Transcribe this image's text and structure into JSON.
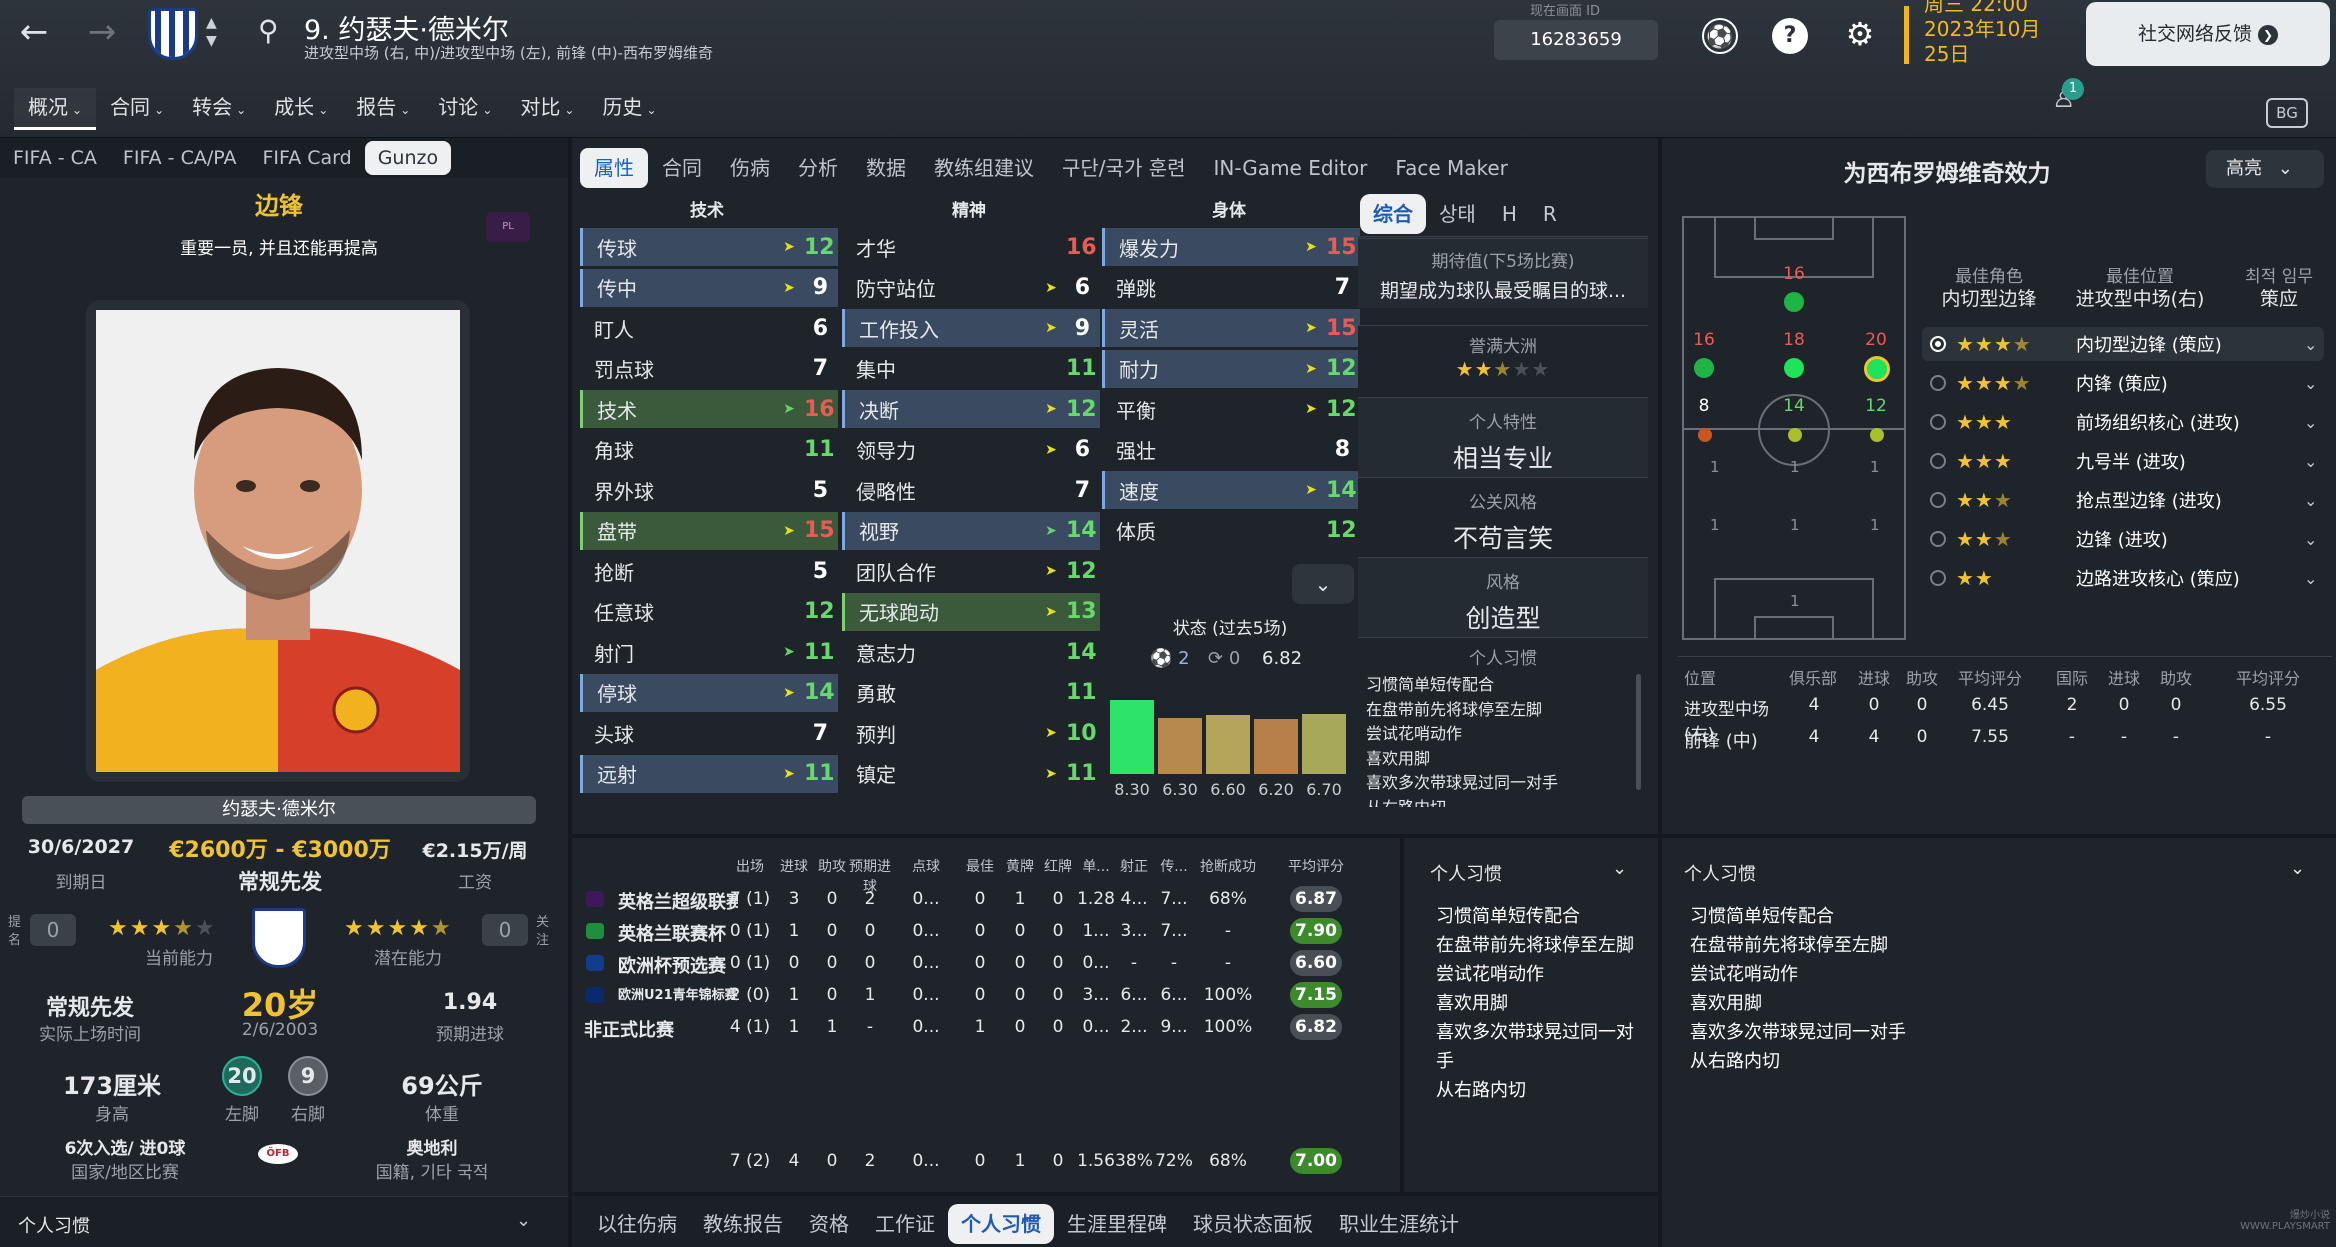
{
  "header": {
    "back_icon": "arrow-left-icon",
    "forward_icon": "arrow-right-icon",
    "player_title": "9. 约瑟夫·德米尔",
    "player_positions": "进攻型中场 (右, 中)/进攻型中场 (左), 前锋 (中)-西布罗姆维奇",
    "id_label": "现在画面 ID",
    "id_value": "16283659",
    "date_line1": "周三 22:00",
    "date_line2": "2023年10月",
    "date_line3": "25日",
    "social_button": "社交网络反馈",
    "notif_count": "1",
    "badge": "BG"
  },
  "main_tabs": [
    {
      "label": "概况"
    },
    {
      "label": "合同"
    },
    {
      "label": "转会"
    },
    {
      "label": "成长"
    },
    {
      "label": "报告"
    },
    {
      "label": "讨论"
    },
    {
      "label": "对比"
    },
    {
      "label": "历史"
    }
  ],
  "sub_tabs": [
    {
      "label": "FIFA - CA"
    },
    {
      "label": "FIFA - CA/PA"
    },
    {
      "label": "FIFA Card"
    },
    {
      "label": "Gunzo"
    }
  ],
  "left": {
    "role": "边锋",
    "role_desc": "重要一员, 并且还能再提高",
    "name_plate": "约瑟夫·德米尔",
    "contract_end": "30/6/2027",
    "contract_end_label": "到期日",
    "value_range": "€2600万 - €3000万",
    "status": "常规先发",
    "wage": "€2.15万/周",
    "wage_label": "工资",
    "left_small_a": "提名",
    "left_box_a": "0",
    "left_small_b": "关注",
    "left_box_b": "0",
    "current_ability_label": "当前能力",
    "potential_label": "潜在能力",
    "playing_time": "常规先发",
    "playing_time_label": "实际上场时间",
    "age": "20岁",
    "dob": "2/6/2003",
    "xg": "1.94",
    "xg_label": "预期进球",
    "height": "173厘米",
    "height_label": "身高",
    "left_foot": "20",
    "left_foot_label": "左脚",
    "right_foot": "9",
    "right_foot_label": "右脚",
    "weight": "69公斤",
    "weight_label": "体重",
    "caps": "6次入选/ 进0球",
    "caps_label": "国家/地区比赛",
    "nation": "奥地利",
    "nation_label": "国籍, 기타 국적",
    "bottom_title": "个人习惯",
    "ofb": "ÖFB"
  },
  "attr_tabs": [
    {
      "label": "属性"
    },
    {
      "label": "合同"
    },
    {
      "label": "伤病"
    },
    {
      "label": "分析"
    },
    {
      "label": "数据"
    },
    {
      "label": "教练组建议"
    },
    {
      "label": "구단/국가 훈련"
    },
    {
      "label": "IN-Game Editor"
    },
    {
      "label": "Face Maker"
    }
  ],
  "attr_headers": {
    "technical": "技术",
    "mental": "精神",
    "physical": "身体"
  },
  "technical": [
    {
      "name": "传球",
      "value": "12"
    },
    {
      "name": "传中",
      "value": "9"
    },
    {
      "name": "盯人",
      "value": "6"
    },
    {
      "name": "罚点球",
      "value": "7"
    },
    {
      "name": "技术",
      "value": "16"
    },
    {
      "name": "角球",
      "value": "11"
    },
    {
      "name": "界外球",
      "value": "5"
    },
    {
      "name": "盘带",
      "value": "15"
    },
    {
      "name": "抢断",
      "value": "5"
    },
    {
      "name": "任意球",
      "value": "12"
    },
    {
      "name": "射门",
      "value": "11"
    },
    {
      "name": "停球",
      "value": "14"
    },
    {
      "name": "头球",
      "value": "7"
    },
    {
      "name": "远射",
      "value": "11"
    }
  ],
  "mental": [
    {
      "name": "才华",
      "value": "16"
    },
    {
      "name": "防守站位",
      "value": "6"
    },
    {
      "name": "工作投入",
      "value": "9"
    },
    {
      "name": "集中",
      "value": "11"
    },
    {
      "name": "决断",
      "value": "12"
    },
    {
      "name": "领导力",
      "value": "6"
    },
    {
      "name": "侵略性",
      "value": "7"
    },
    {
      "name": "视野",
      "value": "14"
    },
    {
      "name": "团队合作",
      "value": "12"
    },
    {
      "name": "无球跑动",
      "value": "13"
    },
    {
      "name": "意志力",
      "value": "14"
    },
    {
      "name": "勇敢",
      "value": "11"
    },
    {
      "name": "预判",
      "value": "10"
    },
    {
      "name": "镇定",
      "value": "11"
    }
  ],
  "physical": [
    {
      "name": "爆发力",
      "value": "15"
    },
    {
      "name": "弹跳",
      "value": "7"
    },
    {
      "name": "灵活",
      "value": "15"
    },
    {
      "name": "耐力",
      "value": "12"
    },
    {
      "name": "平衡",
      "value": "12"
    },
    {
      "name": "强壮",
      "value": "8"
    },
    {
      "name": "速度",
      "value": "14"
    },
    {
      "name": "体质",
      "value": "12"
    }
  ],
  "form": {
    "title": "状态 (过去5场)",
    "goals": "2",
    "assists": "0",
    "avg": "6.82",
    "bars": [
      {
        "label": "8.30",
        "value": 8.3,
        "color": "#2ee36a"
      },
      {
        "label": "6.30",
        "value": 6.3,
        "color": "#b8894e"
      },
      {
        "label": "6.60",
        "value": 6.6,
        "color": "#b4a55a"
      },
      {
        "label": "6.20",
        "value": 6.2,
        "color": "#b77f4a"
      },
      {
        "label": "6.70",
        "value": 6.7,
        "color": "#a7a85a"
      }
    ]
  },
  "overview_tabs": [
    {
      "label": "综合"
    },
    {
      "label": "상태"
    },
    {
      "label": "H"
    },
    {
      "label": "R"
    }
  ],
  "overview": {
    "expect_label": "期待值(下5场比赛)",
    "expect_value": "期望成为球队最受瞩目的球...",
    "rep_label": "誉满大洲",
    "trait_label": "个人特性",
    "trait_value": "相当专业",
    "media_label": "公关风格",
    "media_value": "不苟言笑",
    "style_label": "风格",
    "style_value": "创造型",
    "habits_label": "个人习惯"
  },
  "habits": [
    "习惯简单短传配合",
    "在盘带前先将球停至左脚",
    "尝试花哨动作",
    "喜欢用脚",
    "喜欢多次带球晃过同一对手",
    "从右路内切"
  ],
  "right": {
    "title": "为西布罗姆维奇效力",
    "dropdown": "高亮",
    "best_role_label": "最佳角色",
    "best_role": "内切型边锋",
    "best_pos_label": "最佳位置",
    "best_pos": "进攻型中场(右)",
    "duty_label": "최적 임무",
    "duty": "策应"
  },
  "pitch_labels": {
    "p16a": "16",
    "p16b": "16",
    "p18": "18",
    "p20": "20",
    "p8": "8",
    "p14": "14",
    "p12": "12"
  },
  "roles": [
    {
      "name": "内切型边锋 (策应)",
      "stars": 3.5
    },
    {
      "name": "内锋 (策应)",
      "stars": 3.5
    },
    {
      "name": "前场组织核心 (进攻)",
      "stars": 3
    },
    {
      "name": "九号半 (进攻)",
      "stars": 3
    },
    {
      "name": "抢点型边锋 (进攻)",
      "stars": 2.5
    },
    {
      "name": "边锋 (进攻)",
      "stars": 2.5
    },
    {
      "name": "边路进攻核心 (策应)",
      "stars": 2
    }
  ],
  "pos_table": {
    "headers": [
      "位置",
      "俱乐部",
      "进球",
      "助攻",
      "平均评分",
      "国际",
      "进球",
      "助攻",
      "平均评分"
    ],
    "rows": [
      [
        "进攻型中场 (右)",
        "4",
        "0",
        "0",
        "6.45",
        "2",
        "0",
        "0",
        "6.55"
      ],
      [
        "前锋 (中)",
        "4",
        "4",
        "0",
        "7.55",
        "-",
        "-",
        "-",
        "-"
      ]
    ]
  },
  "stats": {
    "headers": [
      "出场",
      "进球",
      "助攻",
      "预期进球",
      "点球",
      "最佳",
      "黄牌",
      "红牌",
      "单...",
      "射正",
      "传...",
      "抢断成功",
      "平均评分"
    ],
    "rows": [
      {
        "comp": "英格兰超级联赛",
        "cells": [
          "7 (1)",
          "3",
          "0",
          "2",
          "0...",
          "0",
          "1",
          "0",
          "1.28",
          "4...",
          "7...",
          "68%"
        ],
        "rating": "6.87",
        "rc": "rd"
      },
      {
        "comp": "英格兰联赛杯",
        "cells": [
          "0 (1)",
          "1",
          "0",
          "0",
          "0...",
          "0",
          "0",
          "0",
          "1...",
          "3...",
          "7...",
          "-"
        ],
        "rating": "7.90",
        "rc": "rg"
      },
      {
        "comp": "欧洲杯预选赛",
        "cells": [
          "0 (1)",
          "0",
          "0",
          "0",
          "0...",
          "0",
          "0",
          "0",
          "0...",
          "-",
          "-",
          "-"
        ],
        "rating": "6.60",
        "rc": "rd"
      },
      {
        "comp": "欧洲U21青年锦标赛预选赛",
        "cells": [
          "2 (0)",
          "1",
          "0",
          "1",
          "0...",
          "0",
          "0",
          "0",
          "3...",
          "6...",
          "6...",
          "100%"
        ],
        "rating": "7.15",
        "rc": "rg"
      },
      {
        "comp": "非正式比赛",
        "cells": [
          "4 (1)",
          "1",
          "1",
          "-",
          "0...",
          "1",
          "0",
          "0",
          "0...",
          "2...",
          "9...",
          "100%"
        ],
        "rating": "6.82",
        "rc": "rd"
      }
    ],
    "total": [
      "7 (2)",
      "4",
      "0",
      "2",
      "0...",
      "0",
      "1",
      "0",
      "1.56",
      "38%",
      "72%",
      "68%"
    ],
    "total_rating": "7.00"
  },
  "mid_habits_title": "个人习惯",
  "right_habits_title": "个人习惯",
  "bottom_tabs": [
    {
      "label": "以往伤病"
    },
    {
      "label": "教练报告"
    },
    {
      "label": "资格"
    },
    {
      "label": "工作证"
    },
    {
      "label": "个人习惯"
    },
    {
      "label": "生涯里程碑"
    },
    {
      "label": "球员状态面板"
    },
    {
      "label": "职业生涯统计"
    }
  ],
  "watermark": "爆炒小说 WWW.PLAYSMART"
}
